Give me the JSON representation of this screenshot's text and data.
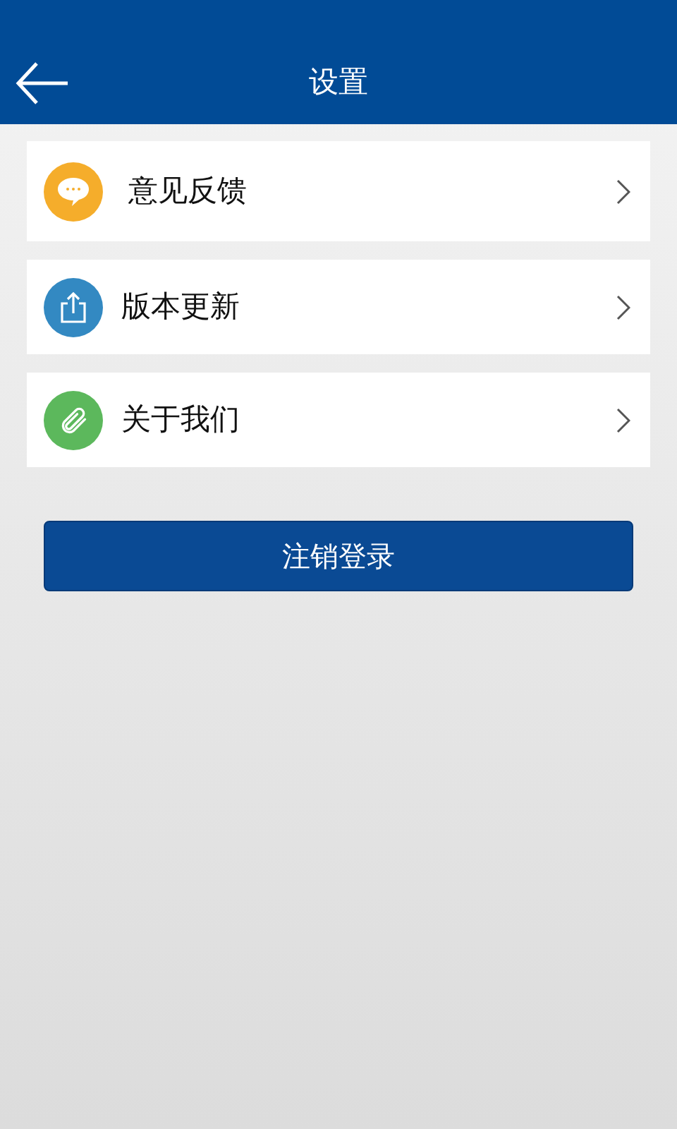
{
  "header": {
    "title": "设置"
  },
  "items": [
    {
      "label": "意见反馈",
      "kind": "chat",
      "color": "#f5ad2b"
    },
    {
      "label": "版本更新",
      "kind": "share",
      "color": "#3389c2"
    },
    {
      "label": "关于我们",
      "kind": "clip",
      "color": "#5cb85c"
    }
  ],
  "logout_button": {
    "label": "注销登录"
  }
}
